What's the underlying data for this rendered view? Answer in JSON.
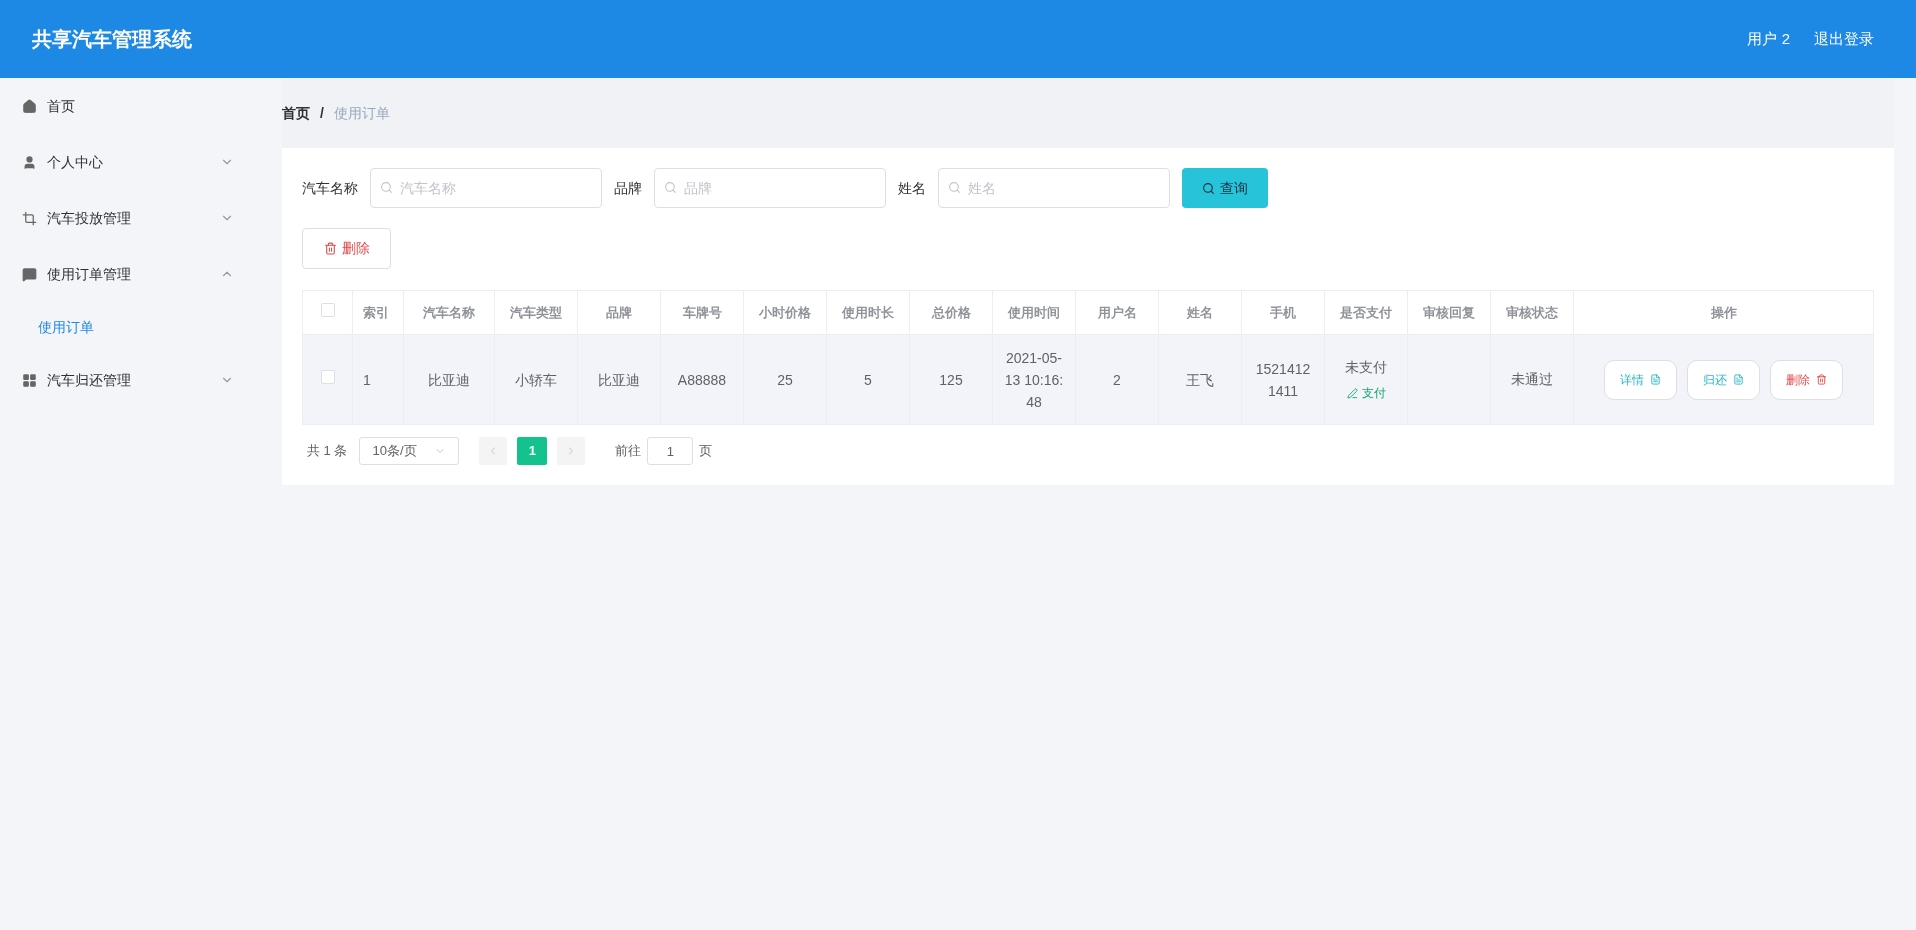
{
  "header": {
    "title": "共享汽车管理系统",
    "user": "用户 2",
    "logout": "退出登录"
  },
  "sidebar": {
    "items": [
      {
        "label": "首页",
        "kind": "link",
        "selected": false
      },
      {
        "label": "个人中心",
        "kind": "menu",
        "expanded": false,
        "selected": false
      },
      {
        "label": "汽车投放管理",
        "kind": "menu",
        "expanded": false,
        "selected": false
      },
      {
        "label": "使用订单管理",
        "kind": "menu",
        "expanded": true,
        "selected": false,
        "children": [
          {
            "label": "使用订单",
            "selected": true
          }
        ]
      },
      {
        "label": "汽车归还管理",
        "kind": "menu",
        "expanded": false,
        "selected": false
      }
    ]
  },
  "breadcrumb": [
    {
      "label": "首页",
      "current": false
    },
    {
      "label": "使用订单",
      "current": true
    }
  ],
  "breadcrumb_separator": "/",
  "search": {
    "fields": [
      {
        "label": "汽车名称",
        "placeholder": "汽车名称"
      },
      {
        "label": "品牌",
        "placeholder": "品牌"
      },
      {
        "label": "姓名",
        "placeholder": "姓名"
      }
    ],
    "button": "查询"
  },
  "toolbar": {
    "delete_button": "删除"
  },
  "table": {
    "all_checked": false,
    "columns": [
      "索引",
      "汽车名称",
      "汽车类型",
      "品牌",
      "车牌号",
      "小时价格",
      "使用时长",
      "总价格",
      "使用时间",
      "用户名",
      "姓名",
      "手机",
      "是否支付",
      "审核回复",
      "审核状态",
      "操作"
    ],
    "rows": [
      {
        "checked": false,
        "cells": [
          "1",
          "比亚迪",
          "小轿车",
          "比亚迪",
          "A88888",
          "25",
          "5",
          "125",
          "2021-05-13 10:16:48",
          "2",
          "王飞",
          "15214121411"
        ],
        "paid": {
          "text": "未支付",
          "action": "支付"
        },
        "review_status": "未通过",
        "actions": [
          {
            "label": "详情",
            "kind": "detail"
          },
          {
            "label": "归还",
            "kind": "return"
          },
          {
            "label": "删除",
            "kind": "delete"
          }
        ]
      }
    ]
  },
  "pagination": {
    "total": "共 1 条",
    "page_size": "10条/页",
    "pages": [
      {
        "label": "1",
        "selected": true
      }
    ],
    "goto": "前往",
    "goto_value": "1",
    "goto_suffix": "页"
  }
}
